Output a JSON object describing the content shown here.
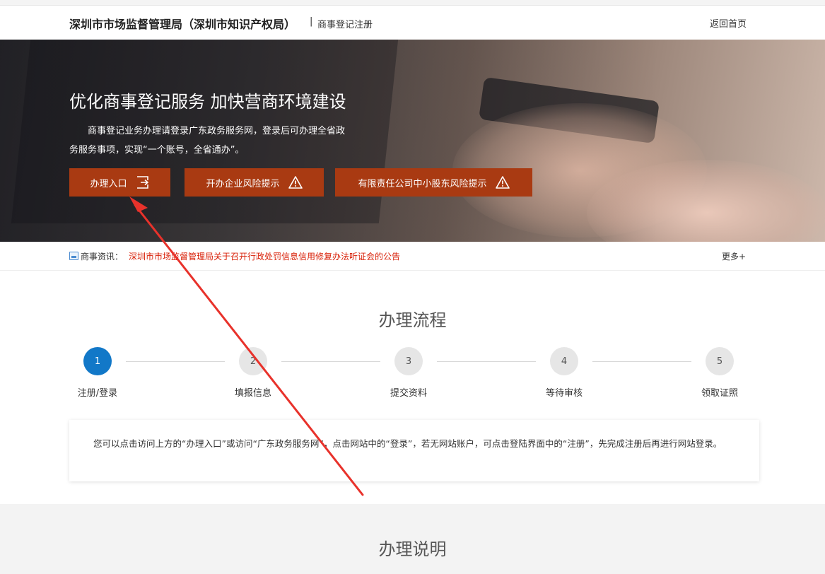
{
  "header": {
    "brand": "深圳市市场监督管理局（深圳市知识产权局）",
    "separator": "|",
    "subtitle": "商事登记注册",
    "home_link": "返回首页"
  },
  "hero": {
    "headline": "优化商事登记服务 加快营商环境建设",
    "description": "商事登记业务办理请登录广东政务服务网，登录后可办理全省政务服务事项，实现“一个账号，全省通办”。",
    "buttons": [
      {
        "label": "办理入口",
        "icon": "login-icon"
      },
      {
        "label": "开办企业风险提示",
        "icon": "warning-icon"
      },
      {
        "label": "有限责任公司中小股东风险提示",
        "icon": "warning-icon"
      }
    ]
  },
  "news": {
    "label": "商事资讯：",
    "headline": "深圳市市场监督管理局关于召开行政处罚信息信用修复办法听证会的公告",
    "more": "更多+"
  },
  "process": {
    "title": "办理流程",
    "active_step": 1,
    "steps": [
      {
        "number": "1",
        "label": "注册/登录"
      },
      {
        "number": "2",
        "label": "填报信息"
      },
      {
        "number": "3",
        "label": "提交资料"
      },
      {
        "number": "4",
        "label": "等待审核"
      },
      {
        "number": "5",
        "label": "领取证照"
      }
    ],
    "note": "您可以点击访问上方的“办理入口”或访问“广东政务服务网”，点击网站中的“登录”，若无网站账户，可点击登陆界面中的“注册”，先完成注册后再进行网站登录。"
  },
  "instructions": {
    "title": "办理说明"
  },
  "colors": {
    "button_bg": "#a93a12",
    "active_step": "#1278c8",
    "news_link": "#d81e06",
    "annotation_arrow": "#e8322b"
  }
}
